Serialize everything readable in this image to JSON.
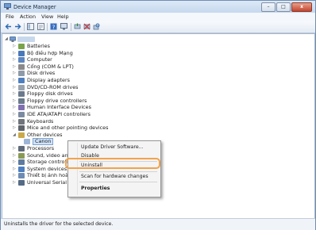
{
  "window": {
    "title": "Device Manager",
    "controls": {
      "minimize": "–",
      "maximize": "□",
      "close": "x"
    }
  },
  "menubar": {
    "items": [
      "File",
      "Action",
      "View",
      "Help"
    ]
  },
  "toolbar": {
    "icons": [
      "back-icon",
      "forward-icon",
      "show-hide-tree-icon",
      "properties-icon",
      "help-icon",
      "monitor-icon",
      "update-driver-icon",
      "disable-device-icon",
      "scan-changes-icon"
    ]
  },
  "tree": {
    "root_label": "",
    "items": [
      {
        "label": "Batteries",
        "icon": "battery-icon"
      },
      {
        "label": "Bộ điều hợp Mạng",
        "icon": "network-adapter-icon"
      },
      {
        "label": "Computer",
        "icon": "computer-icon"
      },
      {
        "label": "Cổng (COM & LPT)",
        "icon": "port-icon"
      },
      {
        "label": "Disk drives",
        "icon": "disk-icon"
      },
      {
        "label": "Display adapters",
        "icon": "display-icon"
      },
      {
        "label": "DVD/CD-ROM drives",
        "icon": "dvd-icon"
      },
      {
        "label": "Floppy disk drives",
        "icon": "floppy-icon"
      },
      {
        "label": "Floppy drive controllers",
        "icon": "floppy-controller-icon"
      },
      {
        "label": "Human Interface Devices",
        "icon": "hid-icon"
      },
      {
        "label": "IDE ATA/ATAPI controllers",
        "icon": "ide-icon"
      },
      {
        "label": "Keyboards",
        "icon": "keyboard-icon"
      },
      {
        "label": "Mice and other pointing devices",
        "icon": "mouse-icon"
      },
      {
        "label": "Other devices",
        "icon": "other-devices-icon",
        "expanded": true
      },
      {
        "label": "Canon",
        "icon": "unknown-device-icon",
        "child": true,
        "selected": true
      },
      {
        "label": "Processors",
        "icon": "processor-icon"
      },
      {
        "label": "Sound, video and",
        "icon": "sound-icon"
      },
      {
        "label": "Storage controlle",
        "icon": "storage-icon"
      },
      {
        "label": "System devices",
        "icon": "system-icon"
      },
      {
        "label": "Thiết bị ảnh hoà",
        "icon": "imaging-icon"
      },
      {
        "label": "Universal Serial Bu",
        "icon": "usb-icon"
      }
    ]
  },
  "context_menu": {
    "items": [
      {
        "label": "Update Driver Software...",
        "bold": false
      },
      {
        "label": "Disable",
        "bold": false
      },
      {
        "label": "Uninstall",
        "bold": false,
        "highlighted": true
      },
      {
        "label": "Scan for hardware changes",
        "bold": false
      },
      {
        "label": "Properties",
        "bold": true
      }
    ],
    "highlight_color": "#f2a34a"
  },
  "statusbar": {
    "text": "Uninstalls the driver for the selected device."
  }
}
